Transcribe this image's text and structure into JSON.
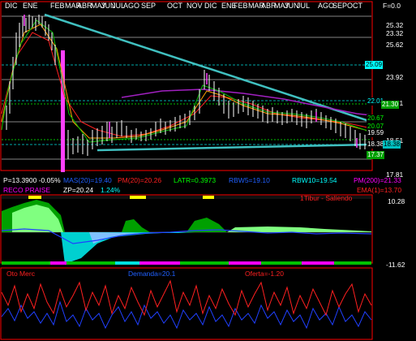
{
  "months": [
    "DIC",
    "ENE",
    "FEB",
    "MAR",
    "ABR",
    "MAY",
    "JUN",
    "JUL",
    "AGO",
    "SEP",
    "OCT",
    "NOV",
    "DIC",
    "ENE",
    "FEB",
    "MAR",
    "ABR",
    "MAY",
    "JUN",
    "JUL",
    "AGO",
    "SEP",
    "OCT"
  ],
  "price_axis": {
    "labels": [
      "F=0.0",
      "25.32",
      "23.32",
      "25.62",
      "23.92",
      "21.71",
      "18.51",
      "17.81"
    ],
    "right_tags": [
      {
        "text": "25.09",
        "bg": "#00ffff",
        "fg": "#000000"
      },
      {
        "text": "22.01",
        "bg": "#000000",
        "fg": "#00ffff"
      },
      {
        "text": "21.30",
        "bg": "#00a000",
        "fg": "#ffffff"
      },
      {
        "text": "20.67",
        "bg": "#000000",
        "fg": "#00ff00"
      },
      {
        "text": "20.07",
        "bg": "#000000",
        "fg": "#00ff00"
      },
      {
        "text": "19.59",
        "bg": "#000000",
        "fg": "#ffffff"
      },
      {
        "text": "18.38",
        "bg": "#000000",
        "fg": "#ffffff"
      },
      {
        "text": "18.38",
        "bg": "#00c0c0",
        "fg": "#000000"
      },
      {
        "text": "17.37",
        "bg": "#00a000",
        "fg": "#ffffff"
      }
    ]
  },
  "info_row1": [
    {
      "text": "P=13.3900  -0.05%",
      "color": "#ffffff"
    },
    {
      "text": "MAS(20)=19.40",
      "color": "#2060ff"
    },
    {
      "text": "PM(20)=20.26",
      "color": "#ff2020"
    },
    {
      "text": "LATR=0.3973",
      "color": "#00ff00"
    },
    {
      "text": "RBW5=19.10",
      "color": "#2060ff"
    },
    {
      "text": "RBW10=19.54",
      "color": "#00ffff"
    },
    {
      "text": "PM(200)=21.33",
      "color": "#ff00ff"
    }
  ],
  "info_row2": [
    {
      "text": "RECO PRAISE",
      "color": "#ff00ff"
    },
    {
      "text": "ZP=20.24",
      "color": "#ffffff"
    },
    {
      "text": "1.24%",
      "color": "#00ffff"
    },
    {
      "text": "EMA(1)=13.70",
      "color": "#ff2020"
    }
  ],
  "oscillator": {
    "top_label": "10.28",
    "bottom_label": "-11.62",
    "signal_label": "1Tibur - Saliendo"
  },
  "volume_panel": {
    "label_left": "Oto Merc",
    "label_mid": "Demanda=20.1",
    "label_right": "Oferta=-1.20"
  },
  "colors": {
    "background": "#000000",
    "border": "#ff0000",
    "trend_line": "#40c0c0",
    "ma_magenta": "#a020c0",
    "ma_red": "#ff2020",
    "ma_green": "#00c000",
    "ma_orange": "#ffa000",
    "osc_green": "#00a000",
    "osc_cyan": "#00d0d0"
  }
}
